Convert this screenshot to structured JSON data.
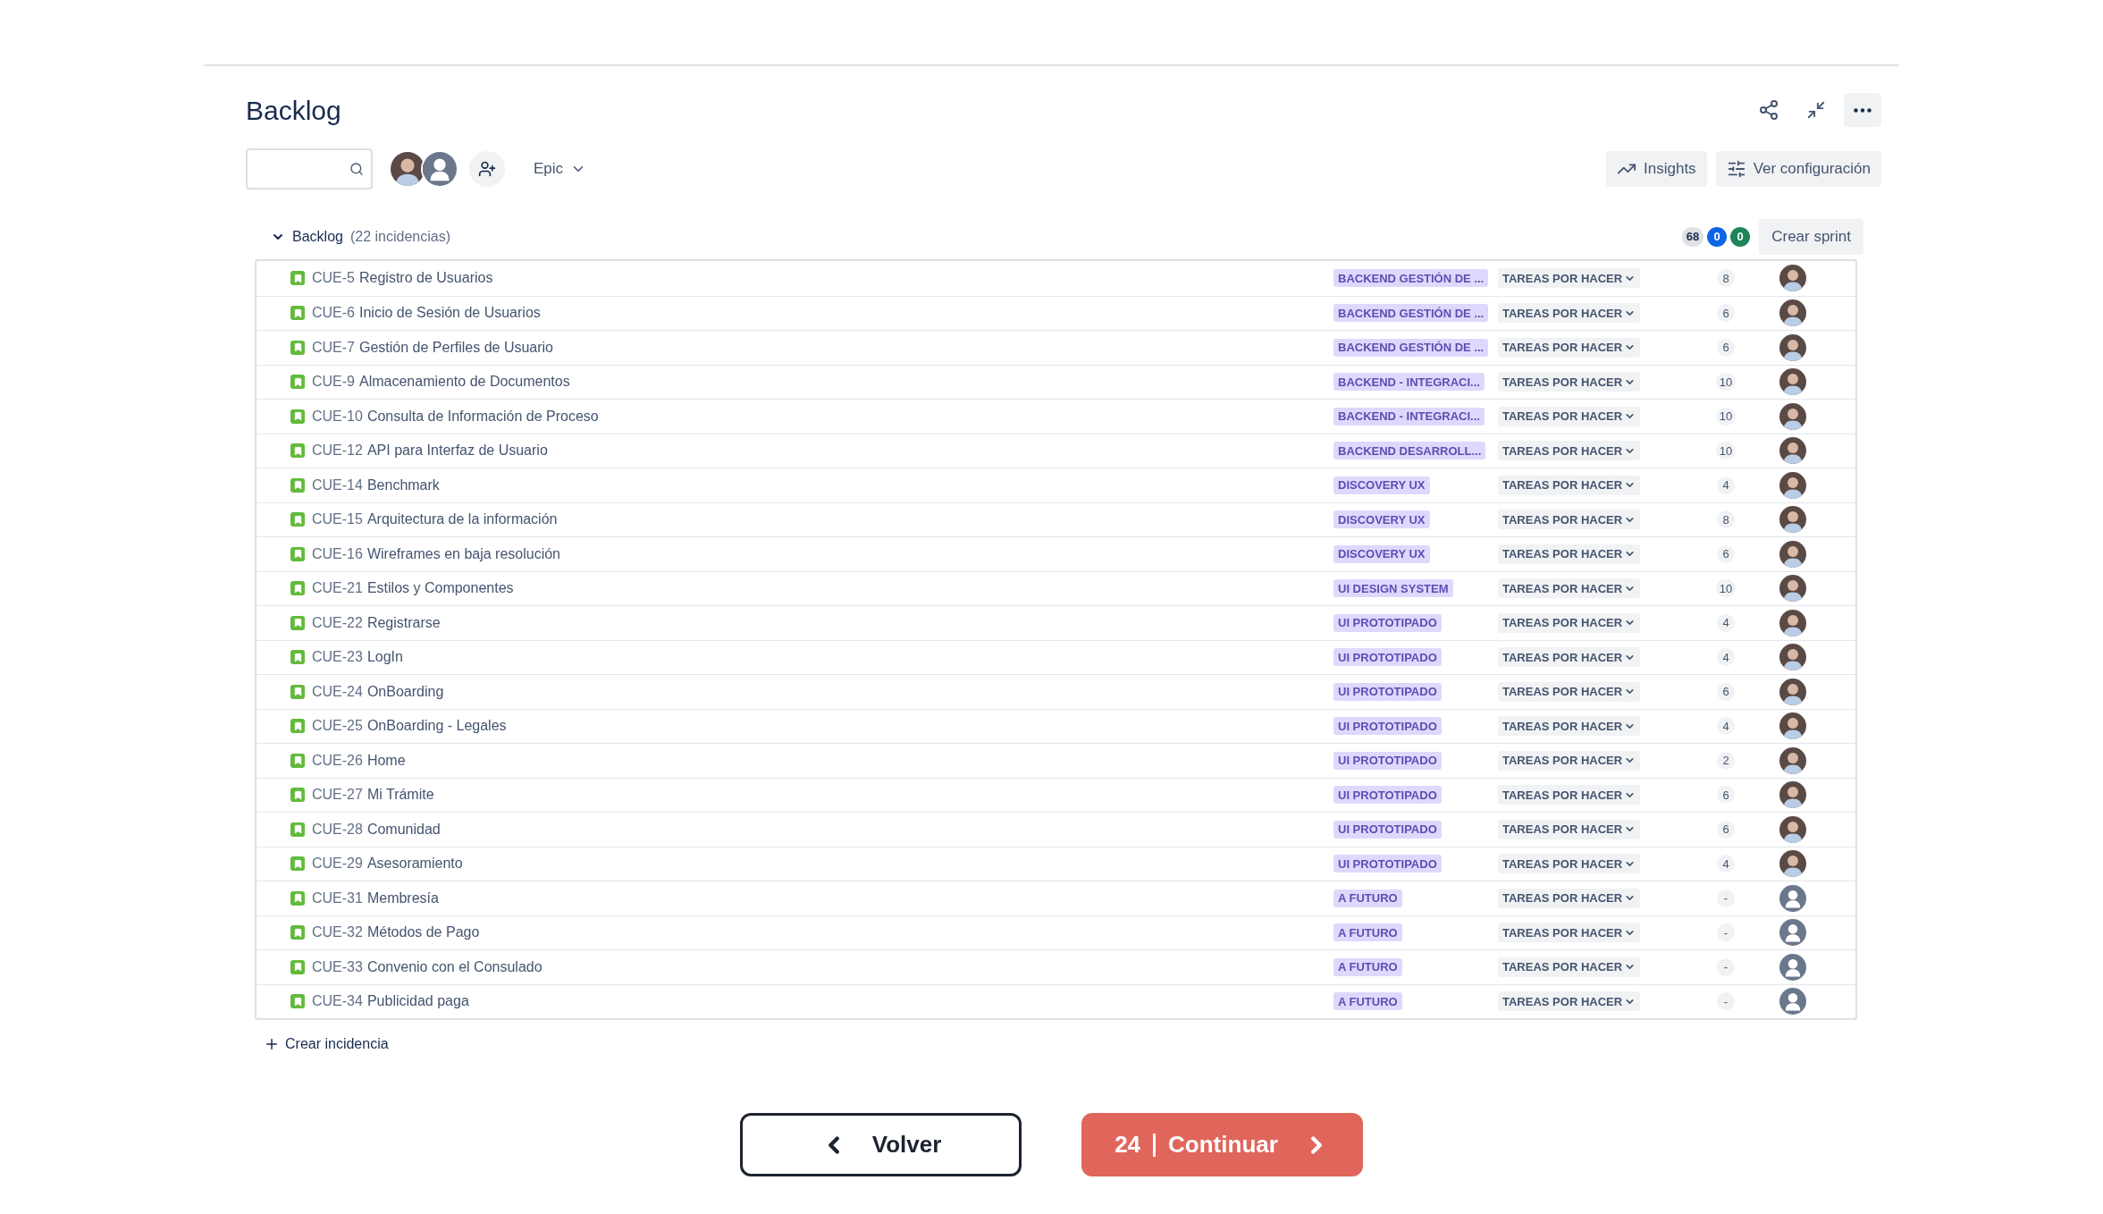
{
  "title": "Backlog",
  "toolbar": {
    "avatars": [
      {
        "kind": "photo"
      },
      {
        "kind": "unassigned"
      }
    ],
    "filter": "Epic",
    "buttons": [
      {
        "kind": "insights",
        "label": "Insights"
      },
      {
        "kind": "settings",
        "label": "Ver configuración"
      }
    ]
  },
  "section": {
    "expanded": true,
    "name": "Backlog",
    "count": "(22 incidencias)",
    "totals": [
      {
        "value": "68",
        "color": "#dfe1e6"
      },
      {
        "value": "0",
        "color": "#0c66e4"
      },
      {
        "value": "0",
        "color": "#1f845a"
      }
    ],
    "create_sprint": "Crear sprint"
  },
  "rows": [
    {
      "key": "CUE-5",
      "summary": "Registro de Usuarios",
      "epic": "BACKEND GESTIÓN DE ...",
      "status": "TAREAS POR HACER",
      "points": "8",
      "assignee": {
        "kind": "photo"
      }
    },
    {
      "key": "CUE-6",
      "summary": "Inicio de Sesión de Usuarios",
      "epic": "BACKEND GESTIÓN DE ...",
      "status": "TAREAS POR HACER",
      "points": "6",
      "assignee": {
        "kind": "photo"
      }
    },
    {
      "key": "CUE-7",
      "summary": "Gestión de Perfiles de Usuario",
      "epic": "BACKEND GESTIÓN DE ...",
      "status": "TAREAS POR HACER",
      "points": "6",
      "assignee": {
        "kind": "photo"
      }
    },
    {
      "key": "CUE-9",
      "summary": "Almacenamiento de Documentos",
      "epic": "BACKEND - INTEGRACI...",
      "status": "TAREAS POR HACER",
      "points": "10",
      "assignee": {
        "kind": "photo"
      }
    },
    {
      "key": "CUE-10",
      "summary": "Consulta de Información de Proceso",
      "epic": "BACKEND - INTEGRACI...",
      "status": "TAREAS POR HACER",
      "points": "10",
      "assignee": {
        "kind": "photo"
      }
    },
    {
      "key": "CUE-12",
      "summary": "API para Interfaz de Usuario",
      "epic": "BACKEND DESARROLL...",
      "status": "TAREAS POR HACER",
      "points": "10",
      "assignee": {
        "kind": "photo"
      }
    },
    {
      "key": "CUE-14",
      "summary": "Benchmark",
      "epic": "DISCOVERY UX",
      "status": "TAREAS POR HACER",
      "points": "4",
      "assignee": {
        "kind": "photo"
      }
    },
    {
      "key": "CUE-15",
      "summary": "Arquitectura de la información",
      "epic": "DISCOVERY UX",
      "status": "TAREAS POR HACER",
      "points": "8",
      "assignee": {
        "kind": "photo"
      }
    },
    {
      "key": "CUE-16",
      "summary": "Wireframes en baja resolución",
      "epic": "DISCOVERY UX",
      "status": "TAREAS POR HACER",
      "points": "6",
      "assignee": {
        "kind": "photo"
      }
    },
    {
      "key": "CUE-21",
      "summary": "Estilos y Componentes",
      "epic": "UI DESIGN SYSTEM",
      "status": "TAREAS POR HACER",
      "points": "10",
      "assignee": {
        "kind": "photo"
      }
    },
    {
      "key": "CUE-22",
      "summary": "Registrarse",
      "epic": "UI PROTOTIPADO",
      "status": "TAREAS POR HACER",
      "points": "4",
      "assignee": {
        "kind": "photo"
      }
    },
    {
      "key": "CUE-23",
      "summary": "LogIn",
      "epic": "UI PROTOTIPADO",
      "status": "TAREAS POR HACER",
      "points": "4",
      "assignee": {
        "kind": "photo"
      }
    },
    {
      "key": "CUE-24",
      "summary": "OnBoarding",
      "epic": "UI PROTOTIPADO",
      "status": "TAREAS POR HACER",
      "points": "6",
      "assignee": {
        "kind": "photo"
      }
    },
    {
      "key": "CUE-25",
      "summary": "OnBoarding - Legales",
      "epic": "UI PROTOTIPADO",
      "status": "TAREAS POR HACER",
      "points": "4",
      "assignee": {
        "kind": "photo"
      }
    },
    {
      "key": "CUE-26",
      "summary": "Home",
      "epic": "UI PROTOTIPADO",
      "status": "TAREAS POR HACER",
      "points": "2",
      "assignee": {
        "kind": "photo"
      }
    },
    {
      "key": "CUE-27",
      "summary": "Mi Trámite",
      "epic": "UI PROTOTIPADO",
      "status": "TAREAS POR HACER",
      "points": "6",
      "assignee": {
        "kind": "photo"
      }
    },
    {
      "key": "CUE-28",
      "summary": "Comunidad",
      "epic": "UI PROTOTIPADO",
      "status": "TAREAS POR HACER",
      "points": "6",
      "assignee": {
        "kind": "photo"
      }
    },
    {
      "key": "CUE-29",
      "summary": "Asesoramiento",
      "epic": "UI PROTOTIPADO",
      "status": "TAREAS POR HACER",
      "points": "4",
      "assignee": {
        "kind": "photo"
      }
    },
    {
      "key": "CUE-31",
      "summary": "Membresía",
      "epic": "A FUTURO",
      "status": "TAREAS POR HACER",
      "points": "-",
      "assignee": {
        "kind": "unassigned"
      }
    },
    {
      "key": "CUE-32",
      "summary": "Métodos de Pago",
      "epic": "A FUTURO",
      "status": "TAREAS POR HACER",
      "points": "-",
      "assignee": {
        "kind": "unassigned"
      }
    },
    {
      "key": "CUE-33",
      "summary": "Convenio con el Consulado",
      "epic": "A FUTURO",
      "status": "TAREAS POR HACER",
      "points": "-",
      "assignee": {
        "kind": "unassigned"
      }
    },
    {
      "key": "CUE-34",
      "summary": "Publicidad paga",
      "epic": "A FUTURO",
      "status": "TAREAS POR HACER",
      "points": "-",
      "assignee": {
        "kind": "unassigned"
      }
    }
  ],
  "create_issue": "Crear incidencia",
  "footer": {
    "back": "Volver",
    "count": "24",
    "continue": "Continuar"
  }
}
